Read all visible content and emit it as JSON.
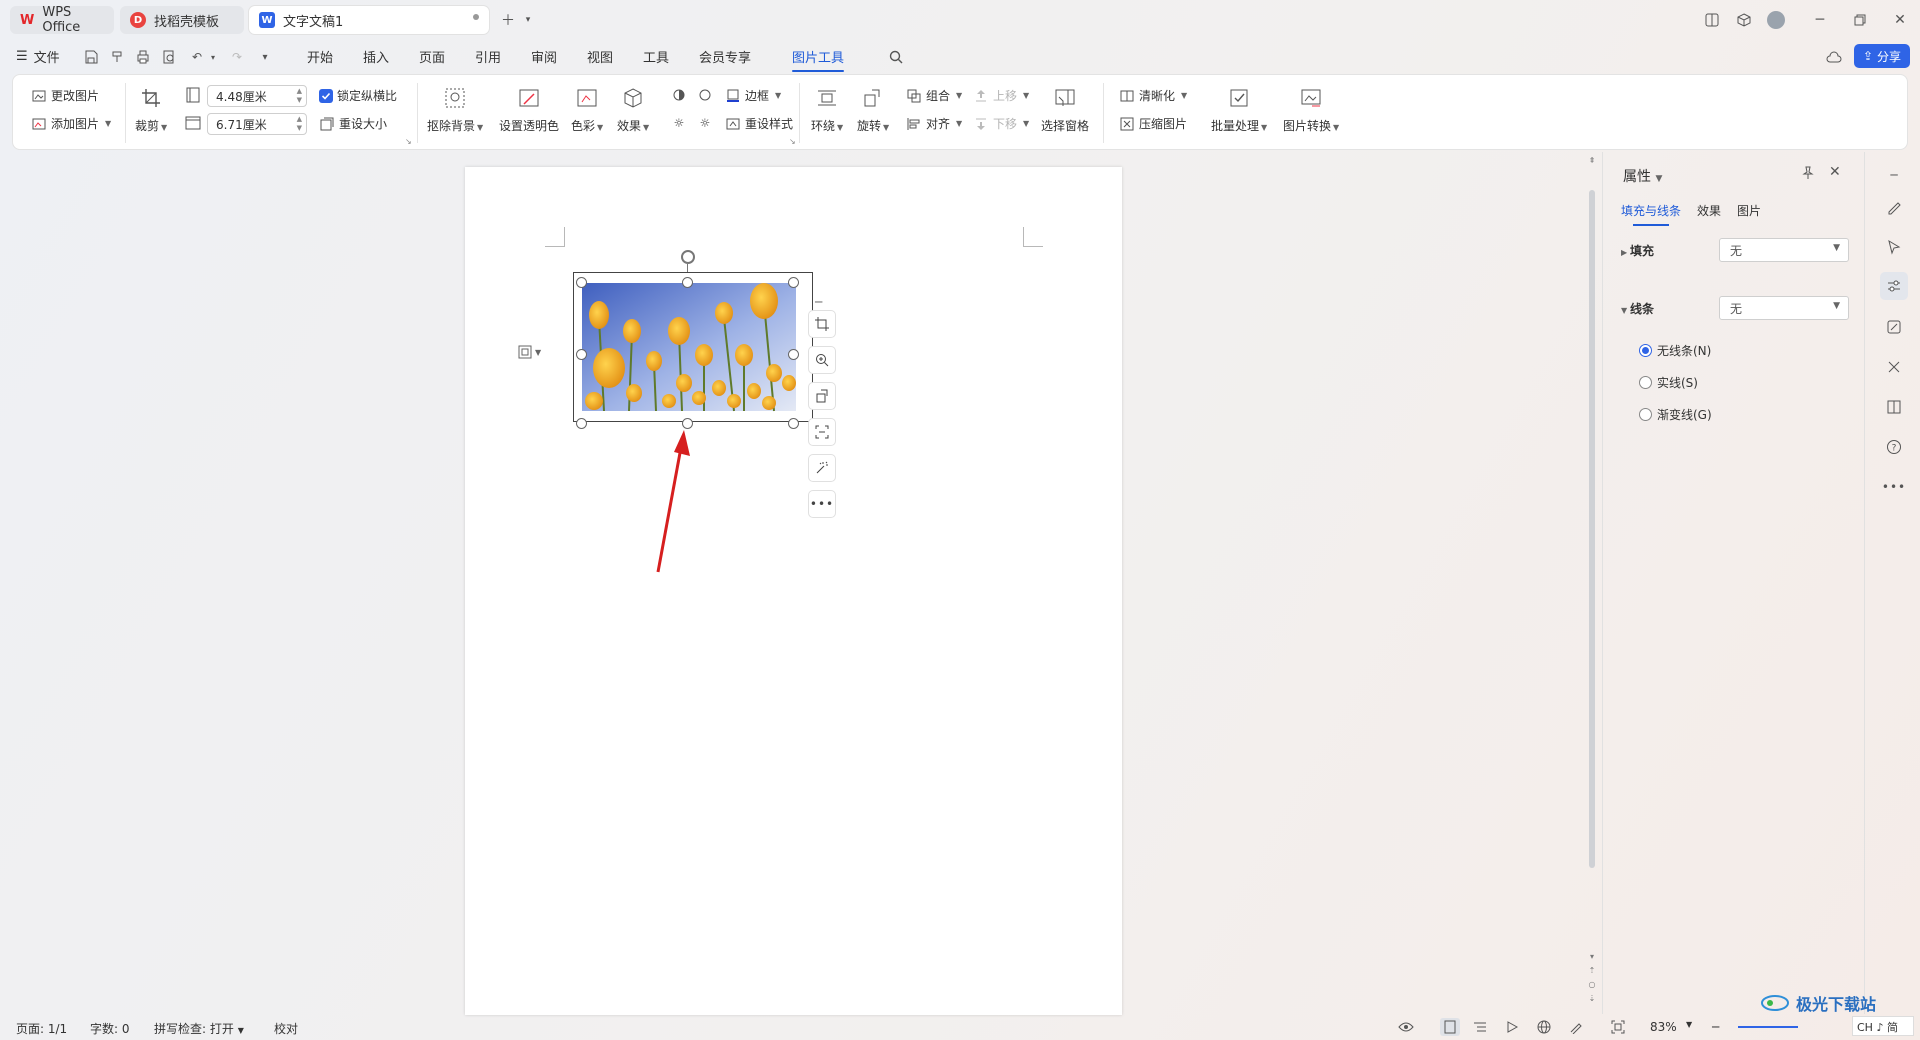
{
  "tabs": [
    {
      "label": "WPS Office",
      "icon": "wps-logo-icon"
    },
    {
      "label": "找稻壳模板",
      "icon": "docer-icon"
    },
    {
      "label": "文字文稿1",
      "icon": "word-doc-icon",
      "active": true
    }
  ],
  "menu": {
    "file": "文件",
    "items": [
      "开始",
      "插入",
      "页面",
      "引用",
      "审阅",
      "视图",
      "工具",
      "会员专享",
      "图片工具"
    ],
    "active": "图片工具",
    "share": "分享"
  },
  "ribbon": {
    "change_image": "更改图片",
    "add_image": "添加图片",
    "crop": "裁剪",
    "height_value": "4.48厘米",
    "width_value": "6.71厘米",
    "lock_ratio": "锁定纵横比",
    "reset_size": "重设大小",
    "remove_bg": "抠除背景",
    "set_transparent": "设置透明色",
    "color": "色彩",
    "effects": "效果",
    "border": "边框",
    "reset_style": "重设样式",
    "wrap": "环绕",
    "rotate": "旋转",
    "group": "组合",
    "align": "对齐",
    "move_up": "上移",
    "move_down": "下移",
    "selection_pane": "选择窗格",
    "sharpen": "清晰化",
    "compress": "压缩图片",
    "batch": "批量处理",
    "convert": "图片转换"
  },
  "panel": {
    "title": "属性",
    "tabs": [
      "填充与线条",
      "效果",
      "图片"
    ],
    "fill_label": "填充",
    "fill_value": "无",
    "line_label": "线条",
    "line_value": "无",
    "line_options": [
      {
        "label": "无线条(N)",
        "selected": true
      },
      {
        "label": "实线(S)",
        "selected": false
      },
      {
        "label": "渐变线(G)",
        "selected": false
      }
    ]
  },
  "status": {
    "page": "页面: 1/1",
    "words": "字数: 0",
    "spell": "拼写检查: 打开",
    "proof": "校对",
    "zoom": "83%"
  },
  "watermark": {
    "text": "极光下载站",
    "ime": "CH ♪ 简"
  },
  "colors": {
    "accent": "#2f64e6",
    "arrow": "#d61f1f"
  }
}
